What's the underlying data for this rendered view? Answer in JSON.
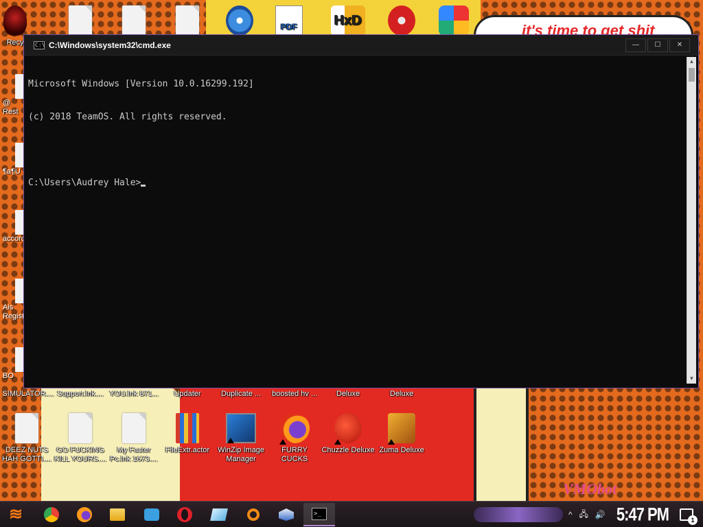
{
  "wallpaper": {
    "bubble_text": "it's time to get shit",
    "signature": "VMObot"
  },
  "desktop_top_icons": [
    {
      "name": "recycle-bin",
      "label": "Recy"
    },
    {
      "name": "file-1",
      "label": ""
    },
    {
      "name": "file-2",
      "label": ""
    },
    {
      "name": "file-3",
      "label": ""
    },
    {
      "name": "disc-app",
      "label": ""
    },
    {
      "name": "pdf-app",
      "label": ""
    },
    {
      "name": "hxd-app",
      "label": ""
    },
    {
      "name": "radiation-app",
      "label": ""
    },
    {
      "name": "colorful-app",
      "label": ""
    }
  ],
  "desktop_left_labels": [
    {
      "label": "@\nRest"
    },
    {
      "label": "¶a¶U"
    },
    {
      "label": "accorc"
    },
    {
      "label": "Ais\nRegist"
    },
    {
      "label": "BO"
    }
  ],
  "desktop_row1_labels": [
    "SIMULATOR....",
    "Support.lnk....",
    "YOU.lnk 871...",
    "Updater",
    "Duplicate ...",
    "boosted hv ...",
    "Deluxe",
    "Deluxe"
  ],
  "desktop_row2_icons": [
    {
      "label": "DEEZ NUTS\nHAH GOTTI...."
    },
    {
      "label": "GO FUCKING\nKILL YOURS...."
    },
    {
      "label": "My Faster\nPc.lnk 1673...."
    },
    {
      "label": "FileExtr.actor"
    },
    {
      "label": "WinZip Image\nManager"
    },
    {
      "label": "FURRY CUCKS"
    },
    {
      "label": "Chuzzle Deluxe"
    },
    {
      "label": "Zuma Deluxe"
    }
  ],
  "cmd": {
    "title": "C:\\Windows\\system32\\cmd.exe",
    "icon_text": "C:\\",
    "minimize": "—",
    "maximize": "☐",
    "close": "✕",
    "lines": [
      "Microsoft Windows [Version 10.0.16299.192]",
      "(c) 2018 TeamOS. All rights reserved.",
      "",
      "C:\\Users\\Audrey Hale>"
    ]
  },
  "taskbar": {
    "start_glyph": "≋",
    "apps": [
      {
        "name": "chrome",
        "color": "#ea4335"
      },
      {
        "name": "firefox",
        "color": "#ff7a1a"
      },
      {
        "name": "file-explorer",
        "color": "#f2c94c"
      },
      {
        "name": "app-blue",
        "color": "#3aa0e0"
      },
      {
        "name": "opera",
        "color": "#e0202a"
      },
      {
        "name": "app-glass",
        "color": "#8fd0f0"
      },
      {
        "name": "search-magnifier",
        "color": "#f28a1a"
      },
      {
        "name": "dropbox-box",
        "color": "#3c6ec8"
      },
      {
        "name": "cmd",
        "color": "#000000"
      }
    ],
    "tray_chevron": "^",
    "network_icon": "🖧",
    "volume_icon": "🔊",
    "clock": "5:47 PM",
    "notification_count": "1"
  }
}
